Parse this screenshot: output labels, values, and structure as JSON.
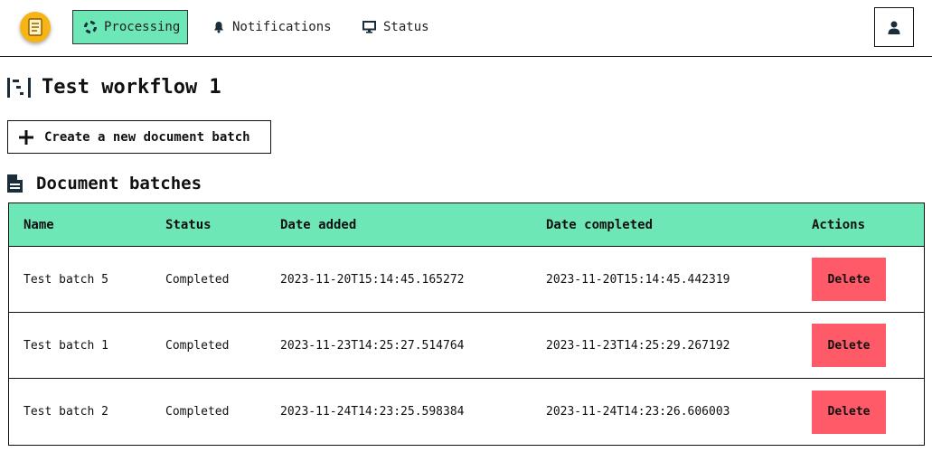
{
  "nav": {
    "logo_icon": "document-icon",
    "items": [
      {
        "label": "Processing",
        "icon": "spinner-icon",
        "active": true
      },
      {
        "label": "Notifications",
        "icon": "bell-icon",
        "active": false
      },
      {
        "label": "Status",
        "icon": "monitor-icon",
        "active": false
      }
    ],
    "user_icon": "user-icon"
  },
  "page": {
    "title": "Test workflow 1",
    "title_icon": "workflow-icon",
    "create_button_label": "Create a new document batch",
    "section_title": "Document batches",
    "section_icon": "file-lines-icon"
  },
  "table": {
    "columns": [
      "Name",
      "Status",
      "Date added",
      "Date completed",
      "Actions"
    ],
    "rows": [
      {
        "name": "Test batch 5",
        "status": "Completed",
        "date_added": "2023-11-20T15:14:45.165272",
        "date_completed": "2023-11-20T15:14:45.442319",
        "action": "Delete"
      },
      {
        "name": "Test batch 1",
        "status": "Completed",
        "date_added": "2023-11-23T14:25:27.514764",
        "date_completed": "2023-11-23T14:25:29.267192",
        "action": "Delete"
      },
      {
        "name": "Test batch 2",
        "status": "Completed",
        "date_added": "2023-11-24T14:23:25.598384",
        "date_completed": "2023-11-24T14:23:26.606003",
        "action": "Delete"
      }
    ]
  },
  "colors": {
    "accent": "#6ee7b7",
    "delete": "#ff5a68",
    "logo": "#f7b416"
  }
}
